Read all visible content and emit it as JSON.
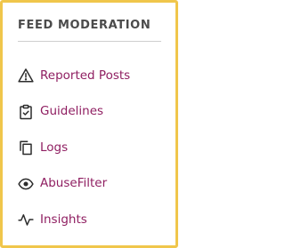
{
  "panel": {
    "title": "FEED MODERATION",
    "accent_border_color": "#f0c64b",
    "link_color": "#8f1e61",
    "items": [
      {
        "label": "Reported Posts",
        "icon": "warning-icon"
      },
      {
        "label": "Guidelines",
        "icon": "clipboard-check-icon"
      },
      {
        "label": "Logs",
        "icon": "copy-icon"
      },
      {
        "label": "AbuseFilter",
        "icon": "eye-icon"
      },
      {
        "label": "Insights",
        "icon": "activity-icon"
      }
    ]
  }
}
